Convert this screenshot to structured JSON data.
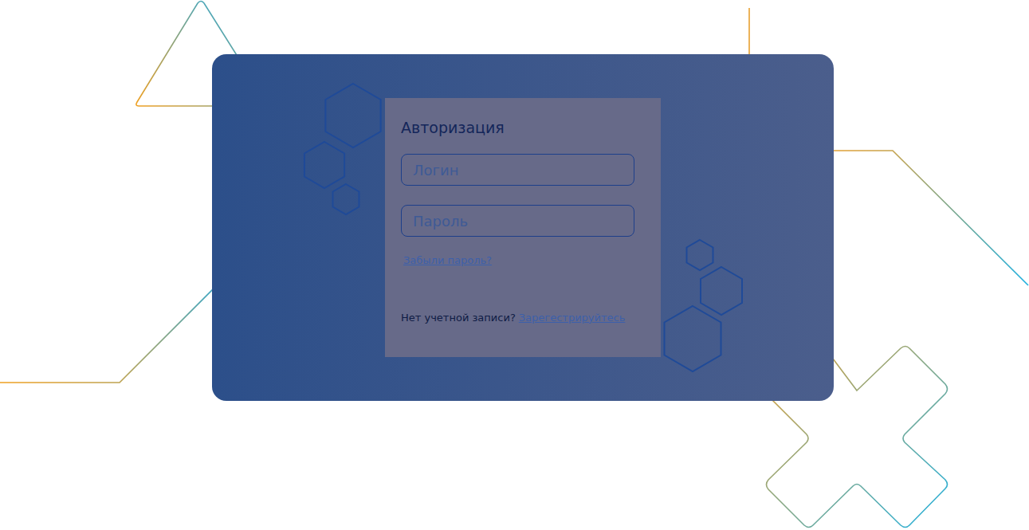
{
  "form": {
    "title": "Авторизация",
    "fields": [
      {
        "name": "login",
        "placeholder": "Логин"
      },
      {
        "name": "password",
        "placeholder": "Пароль"
      }
    ],
    "forgot_link": "Забыли пароль?",
    "footer": {
      "text": "Нет учетной записи?",
      "link": "Зарегестрируйтесь"
    }
  }
}
